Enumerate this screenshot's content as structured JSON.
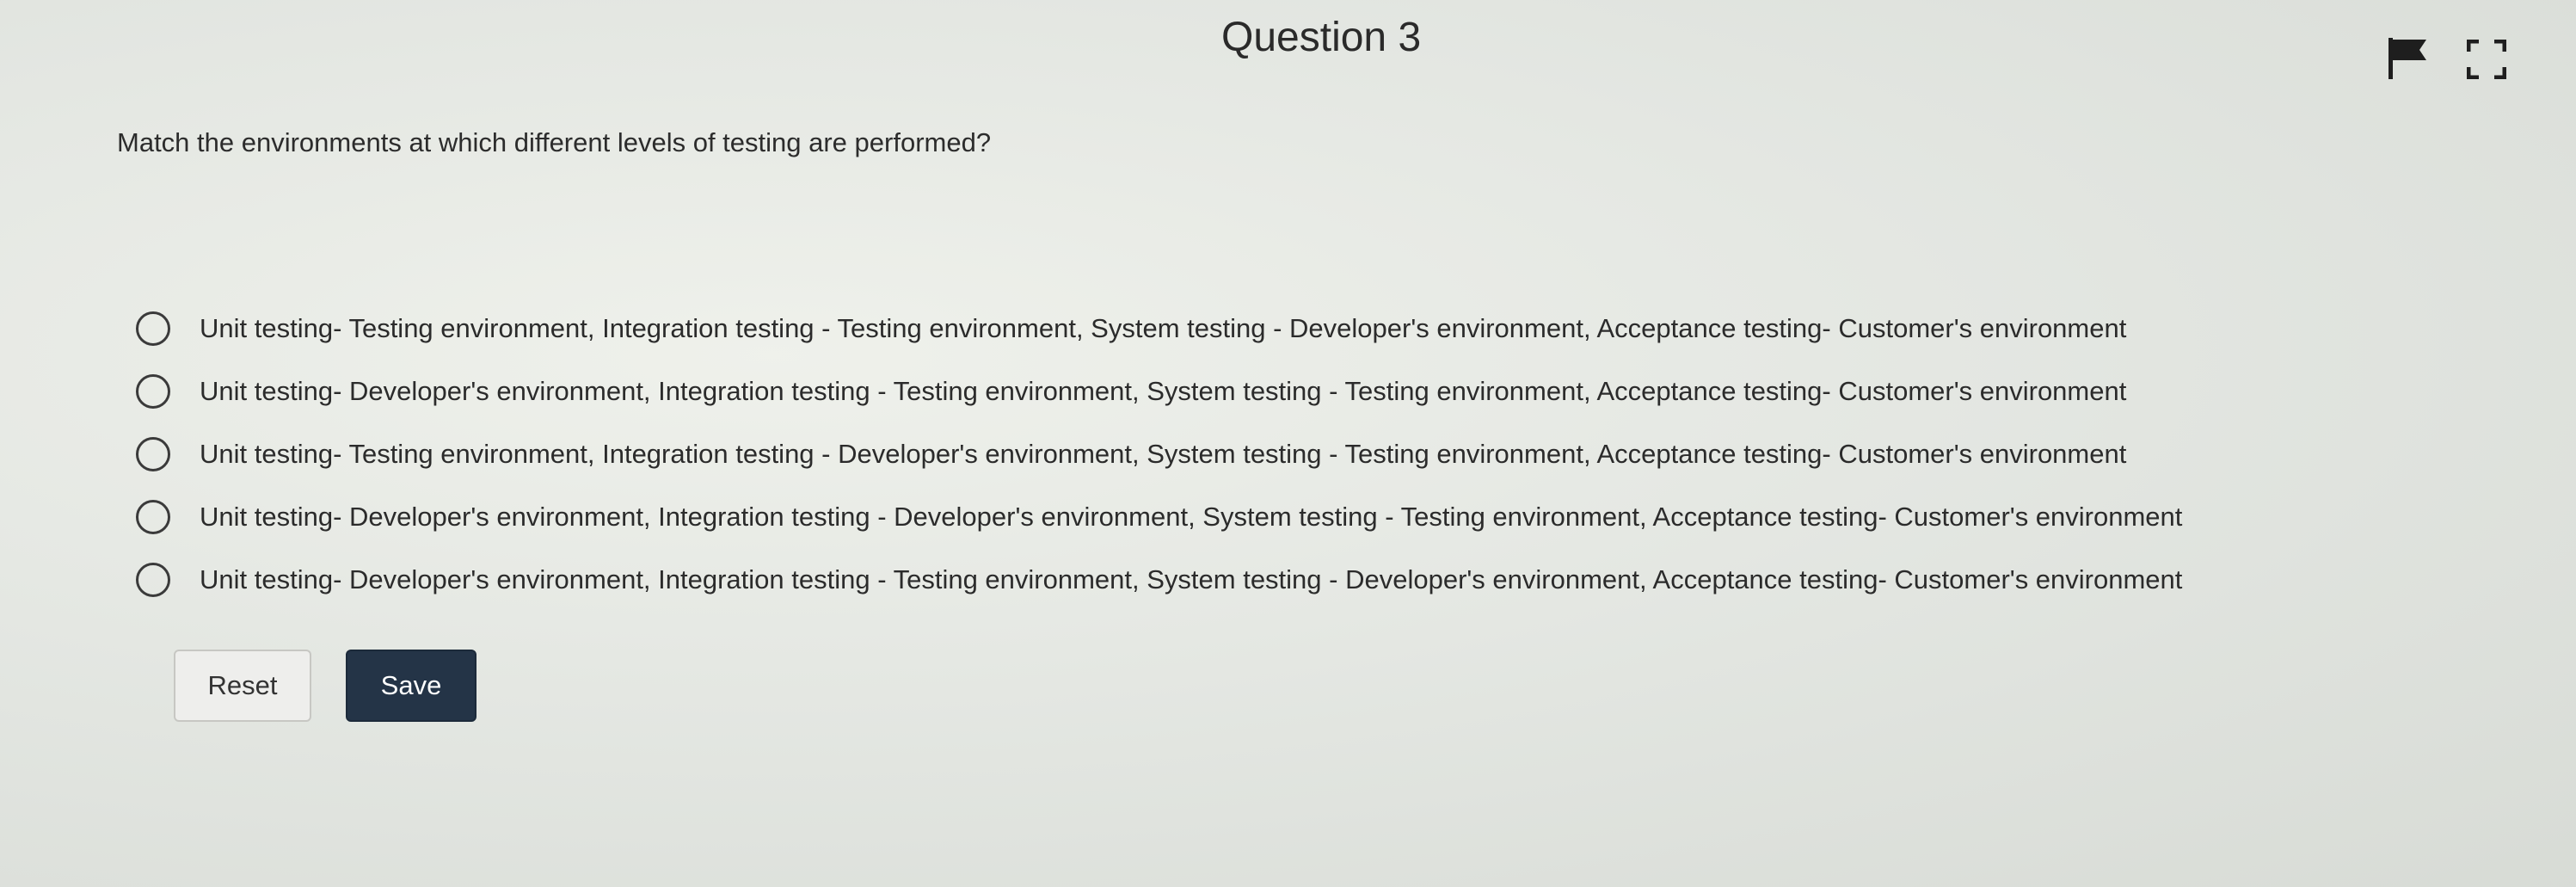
{
  "header": {
    "title": "Question 3",
    "flag_icon": "flag-icon",
    "expand_icon": "fullscreen-icon"
  },
  "question": {
    "text": "Match the environments at which different levels of testing are performed?"
  },
  "options": [
    "Unit testing- Testing environment, Integration testing - Testing environment, System testing - Developer's environment, Acceptance testing- Customer's environment",
    "Unit testing- Developer's environment, Integration testing - Testing environment, System testing - Testing environment, Acceptance testing- Customer's environment",
    "Unit testing- Testing environment, Integration testing - Developer's environment, System testing - Testing environment, Acceptance testing- Customer's environment",
    "Unit testing- Developer's environment, Integration testing - Developer's environment, System testing - Testing environment, Acceptance testing- Customer's environment",
    "Unit testing- Developer's environment, Integration testing - Testing environment, System testing - Developer's environment, Acceptance testing- Customer's environment"
  ],
  "buttons": {
    "reset_label": "Reset",
    "save_label": "Save"
  },
  "colors": {
    "save_bg": "#243447",
    "reset_bg": "#eeeeec",
    "text": "#2c2c2c"
  }
}
